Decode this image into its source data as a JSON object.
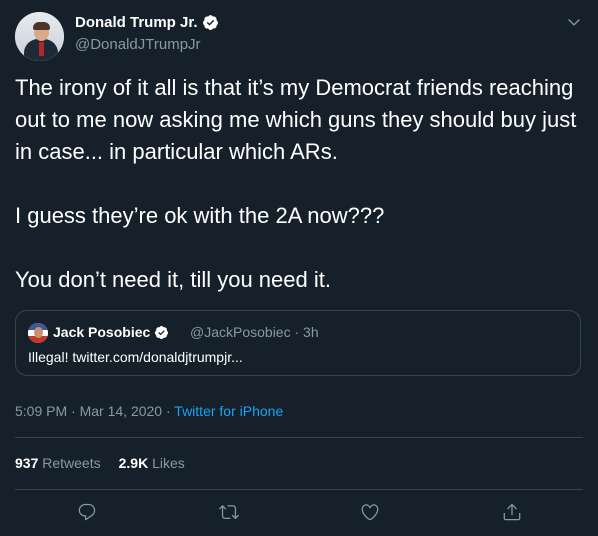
{
  "author": {
    "name": "Donald Trump Jr.",
    "handle": "@DonaldJTrumpJr",
    "verified": true
  },
  "tweet": {
    "paragraphs": [
      "The irony of it all is that it’s my Democrat friends reaching out to me now asking me which guns they should buy just in case... in particular which ARs.",
      "I guess they’re ok with the 2A now???",
      "You don’t need it, till you need it."
    ]
  },
  "quoted_tweet": {
    "name": "Jack Posobiec",
    "handle": "@JackPosobiec",
    "separator": "·",
    "time": "3h",
    "text": "Illegal! twitter.com/donaldjtrumpjr..."
  },
  "meta": {
    "time": "5:09 PM",
    "separator": "·",
    "date": "Mar 14, 2020",
    "separator2": "·",
    "source": "Twitter for iPhone"
  },
  "stats": {
    "retweets_count": "937",
    "retweets_label": "Retweets",
    "likes_count": "2.9K",
    "likes_label": "Likes"
  },
  "colors": {
    "background": "#15202b",
    "text": "#ffffff",
    "muted": "#8899a6",
    "accent": "#1da1f2",
    "border": "#38444d"
  },
  "icons": [
    "caret-down-icon",
    "verified-badge-icon",
    "reply-icon",
    "retweet-icon",
    "like-icon",
    "share-icon"
  ]
}
